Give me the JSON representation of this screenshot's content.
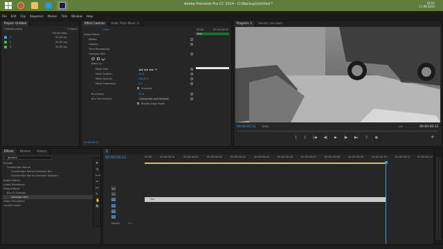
{
  "taskbar": {
    "app_title": "Adobe Premiere Pro CC 2014 - D:\\Backup\\Untitled *",
    "time": "22:22",
    "date": "17.06.2015",
    "icons": [
      "start-icon",
      "chrome-icon",
      "folder-icon",
      "skype-icon",
      "premiere-icon"
    ]
  },
  "menubar": {
    "items": [
      "File",
      "Edit",
      "Clip",
      "Sequence",
      "Marker",
      "Title",
      "Window",
      "Help"
    ]
  },
  "project": {
    "tab": "Project: Untitled",
    "file": "Untitled.prproj",
    "column_frame_rate": "Frame Rate",
    "items": [
      {
        "name": "1",
        "rate": "29,00 fps",
        "color": "#3c9ee8"
      },
      {
        "name": "2",
        "rate": "29,00 fps",
        "color": "#4bb84b"
      },
      {
        "name": "3",
        "rate": "29,00 fps",
        "color": "#4bb84b"
      }
    ],
    "count": "3 Items"
  },
  "effect_controls": {
    "tab": "Effect Controls",
    "tab2": "Audio Track Mixer: 2",
    "clip": "* line",
    "section_video": "Video Effects",
    "rows": [
      "Motion",
      "Opacity",
      "Time Remapping",
      "Gaussian Blur"
    ],
    "mask": "Mask (1)",
    "mask_rows": [
      "Mask Path",
      "Mask Feather",
      "Mask Opacity",
      "Mask Expansion"
    ],
    "mask_values": [
      "",
      "10,0",
      "100,0 %",
      "0,0"
    ],
    "inverted_label": "Inverted",
    "blurriness_label": "Blurriness",
    "blurriness_value": "10,0",
    "blur_dim_label": "Blur Dimensions",
    "blur_dim_value": "Horizontal and Vertical",
    "repeat_label": "Repeat Edge Pixels",
    "timecode": "00:00:00:11",
    "ruler": [
      "00:00",
      "00:00:00:05"
    ],
    "clip_bar": "line"
  },
  "program": {
    "tab": "Program: 1",
    "tab2": "Source: (no clips)",
    "timecode": "00:00:00:11",
    "zoom": "150%",
    "quality": "1/2",
    "duration": "00:00:00:12"
  },
  "effects": {
    "tabs": [
      "Effects",
      "Markers",
      "History"
    ],
    "search": "gaussia",
    "tree": [
      {
        "label": "Presets",
        "indent": 0
      },
      {
        "label": "Convolution Kernel",
        "indent": 1
      },
      {
        "label": "Convolution Kernel Gaussian Blur",
        "indent": 2
      },
      {
        "label": "Convolution Kernel Gaussian Sharpen",
        "indent": 2
      },
      {
        "label": "Audio Effects",
        "indent": 0
      },
      {
        "label": "Audio Transitions",
        "indent": 0
      },
      {
        "label": "Video Effects",
        "indent": 0
      },
      {
        "label": "Blur & Sharpen",
        "indent": 1
      },
      {
        "label": "Gaussian Blur",
        "indent": 2,
        "selected": true
      },
      {
        "label": "Video Transitions",
        "indent": 0
      },
      {
        "label": "Lumetri Looks",
        "indent": 0
      }
    ]
  },
  "timeline": {
    "tab": "1",
    "timecode": "00:00:00:11",
    "ruler": [
      "00:00",
      "00:00:00:01",
      "00:00:00:02",
      "00:00:00:03",
      "00:00:00:04",
      "00:00:00:05",
      "00:00:00:06",
      "00:00:00:07",
      "00:00:00:08",
      "00:00:00:09",
      "00:00:00:10",
      "00:00:00:11",
      "00:00:00:12"
    ],
    "video_tracks": [
      "V3",
      "V2",
      "V1"
    ],
    "audio_tracks": [
      "A1",
      "A2",
      "A3"
    ],
    "master": "Master",
    "master_value": "0,0",
    "clip_name": "line",
    "playhead_fraction": 0.917
  }
}
